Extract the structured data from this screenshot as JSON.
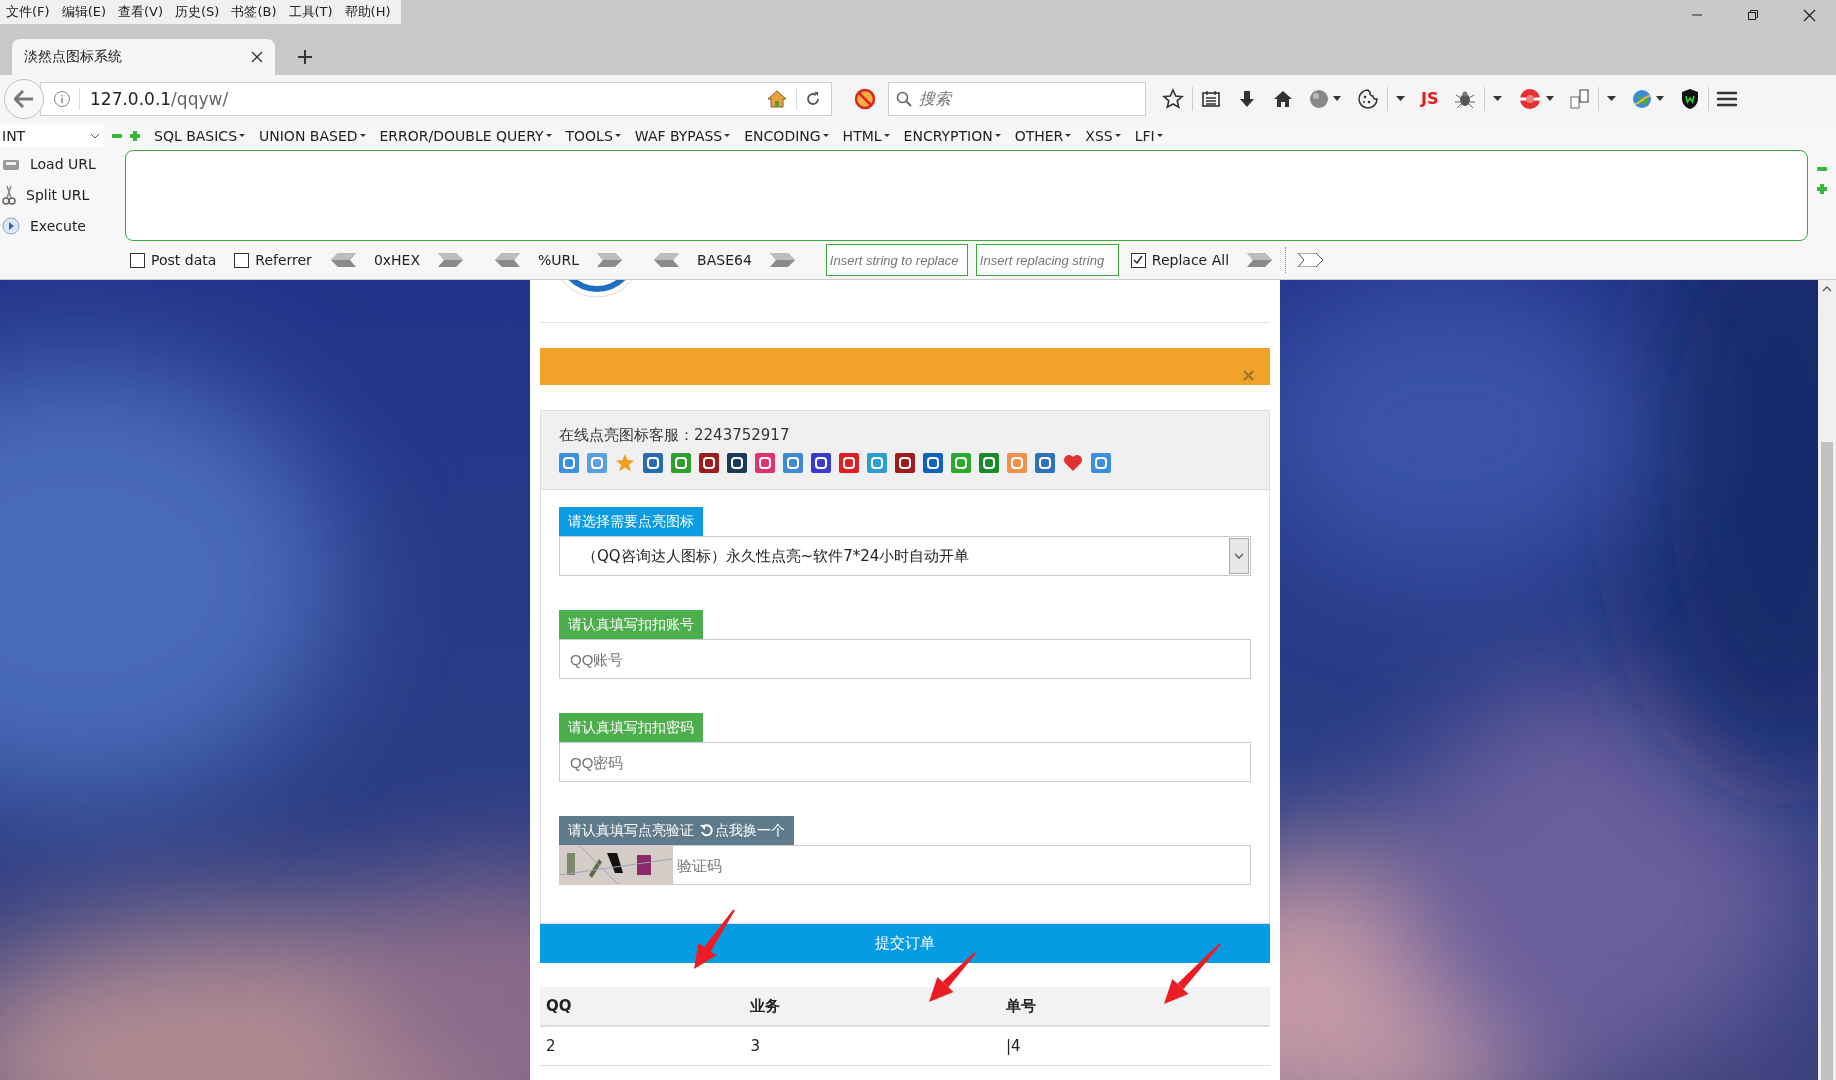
{
  "menu_bar": [
    "文件(F)",
    "编辑(E)",
    "查看(V)",
    "历史(S)",
    "书签(B)",
    "工具(T)",
    "帮助(H)"
  ],
  "tabs": [
    {
      "title": "淡然点图标系统",
      "selected": true
    }
  ],
  "address_bar": {
    "host": "127.0.0.1",
    "path": "/qqyw/"
  },
  "search": {
    "placeholder": "搜索"
  },
  "toolbar": {
    "js_label": "JS"
  },
  "hackbar": {
    "encoding": "INT",
    "menus": [
      "SQL BASICS",
      "UNION BASED",
      "ERROR/DOUBLE QUERY",
      "TOOLS",
      "WAF BYPASS",
      "ENCODING",
      "HTML",
      "ENCRYPTION",
      "OTHER",
      "XSS",
      "LFI"
    ],
    "actions": [
      "Load URL",
      "Split URL",
      "Execute"
    ],
    "options": [
      {
        "label": "Post data",
        "checked": false
      },
      {
        "label": "Referrer",
        "checked": false
      }
    ],
    "encoders": [
      "0xHEX",
      "%URL",
      "BASE64"
    ],
    "replace_from": {
      "placeholder": "Insert string to replace"
    },
    "replace_to": {
      "placeholder": "Insert replacing string"
    },
    "replace_all": {
      "label": "Replace All",
      "checked": true
    }
  },
  "page": {
    "alert": {
      "close": "×"
    },
    "service": {
      "text": "在线点亮图标客服：2243752917"
    },
    "fields": [
      {
        "kind": "select",
        "label": "请选择需要点亮图标",
        "value": "（QQ咨询达人图标）永久性点亮~软件7*24小时自动开单"
      },
      {
        "kind": "text",
        "label": "请认真填写扣扣账号",
        "placeholder": "QQ账号"
      },
      {
        "kind": "text",
        "label": "请认真填写扣扣密码",
        "placeholder": "QQ密码"
      },
      {
        "kind": "captcha",
        "label": "请认真填写点亮验证",
        "link": "点我换一个",
        "placeholder": "验证码"
      }
    ],
    "submit": "提交订单",
    "table": {
      "columns": [
        "QQ",
        "业务",
        "单号"
      ],
      "rows": [
        [
          "2",
          "3",
          "|4"
        ]
      ]
    }
  }
}
